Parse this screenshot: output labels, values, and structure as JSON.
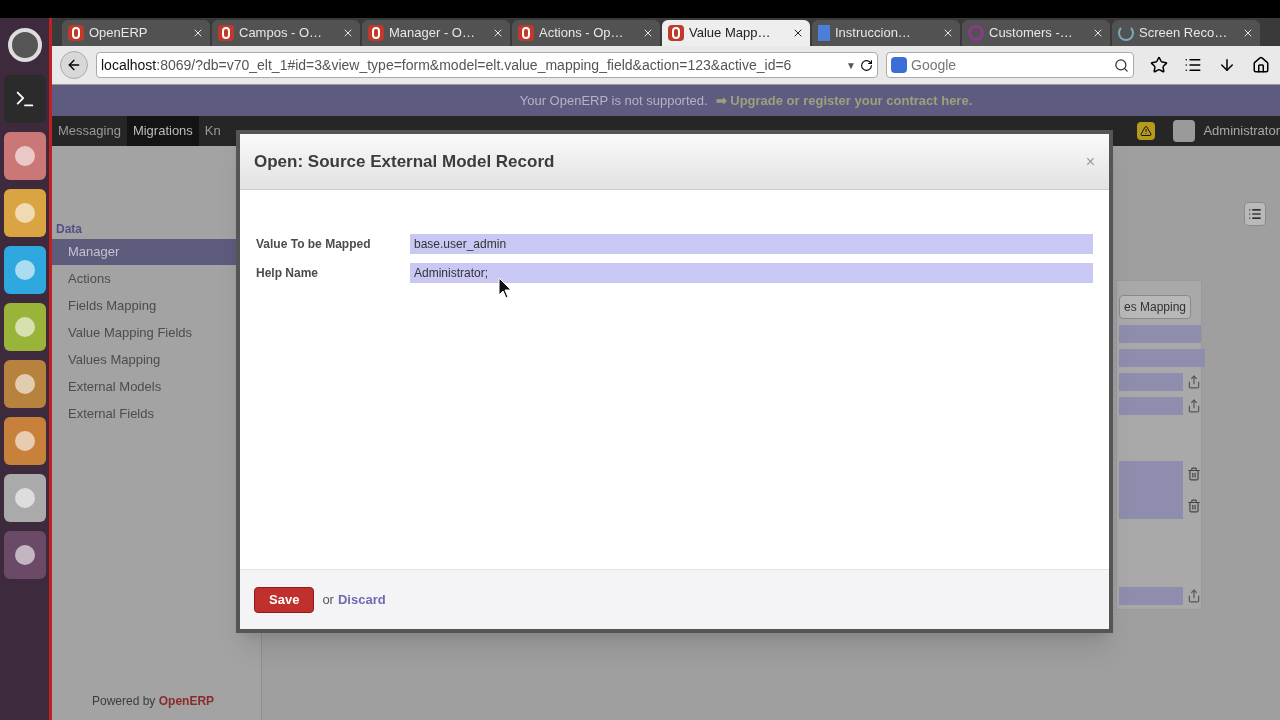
{
  "browser": {
    "tabs": [
      {
        "label": "OpenERP",
        "selected": false,
        "kind": "openerp"
      },
      {
        "label": "Campos - O…",
        "selected": false,
        "kind": "openerp"
      },
      {
        "label": "Manager - O…",
        "selected": false,
        "kind": "openerp"
      },
      {
        "label": "Actions - Op…",
        "selected": false,
        "kind": "openerp"
      },
      {
        "label": "Value Mapp…",
        "selected": true,
        "kind": "openerp"
      },
      {
        "label": "Instruccion…",
        "selected": false,
        "kind": "doc"
      },
      {
        "label": "Customers -…",
        "selected": false,
        "kind": "ring"
      },
      {
        "label": "Screen Reco…",
        "selected": false,
        "kind": "spinner"
      }
    ],
    "url_host": "localhost",
    "url_rest": ":8069/?db=v70_elt_1#id=3&view_type=form&model=elt.value_mapping_field&action=123&active_id=6",
    "url_dropdown": "▼",
    "search_placeholder": "Google"
  },
  "banner": {
    "text": "Your OpenERP is not supported.",
    "link_arrow": "➡",
    "link": "Upgrade or register your contract here."
  },
  "menu": [
    {
      "label": "Messaging",
      "selected": false
    },
    {
      "label": "Migrations",
      "selected": true
    },
    {
      "label": "Kn",
      "selected": false
    }
  ],
  "user": "Administrator",
  "sidebar": {
    "section": "Data",
    "items": [
      {
        "label": "Manager",
        "selected": true
      },
      {
        "label": "Actions",
        "selected": false
      },
      {
        "label": "Fields Mapping",
        "selected": false
      },
      {
        "label": "Value Mapping Fields",
        "selected": false
      },
      {
        "label": "Values Mapping",
        "selected": false
      },
      {
        "label": "External Models",
        "selected": false
      },
      {
        "label": "External Fields",
        "selected": false
      }
    ]
  },
  "background": {
    "button": "es Mapping"
  },
  "footer": {
    "prefix": "Powered by",
    "brand": "OpenERP"
  },
  "dialog": {
    "title": "Open: Source External Model Record",
    "close": "×",
    "fields": [
      {
        "label": "Value To be Mapped",
        "value": "base.user_admin"
      },
      {
        "label": "Help Name",
        "value": "Administrator;"
      }
    ],
    "save": "Save",
    "or": "or",
    "discard": "Discard"
  }
}
